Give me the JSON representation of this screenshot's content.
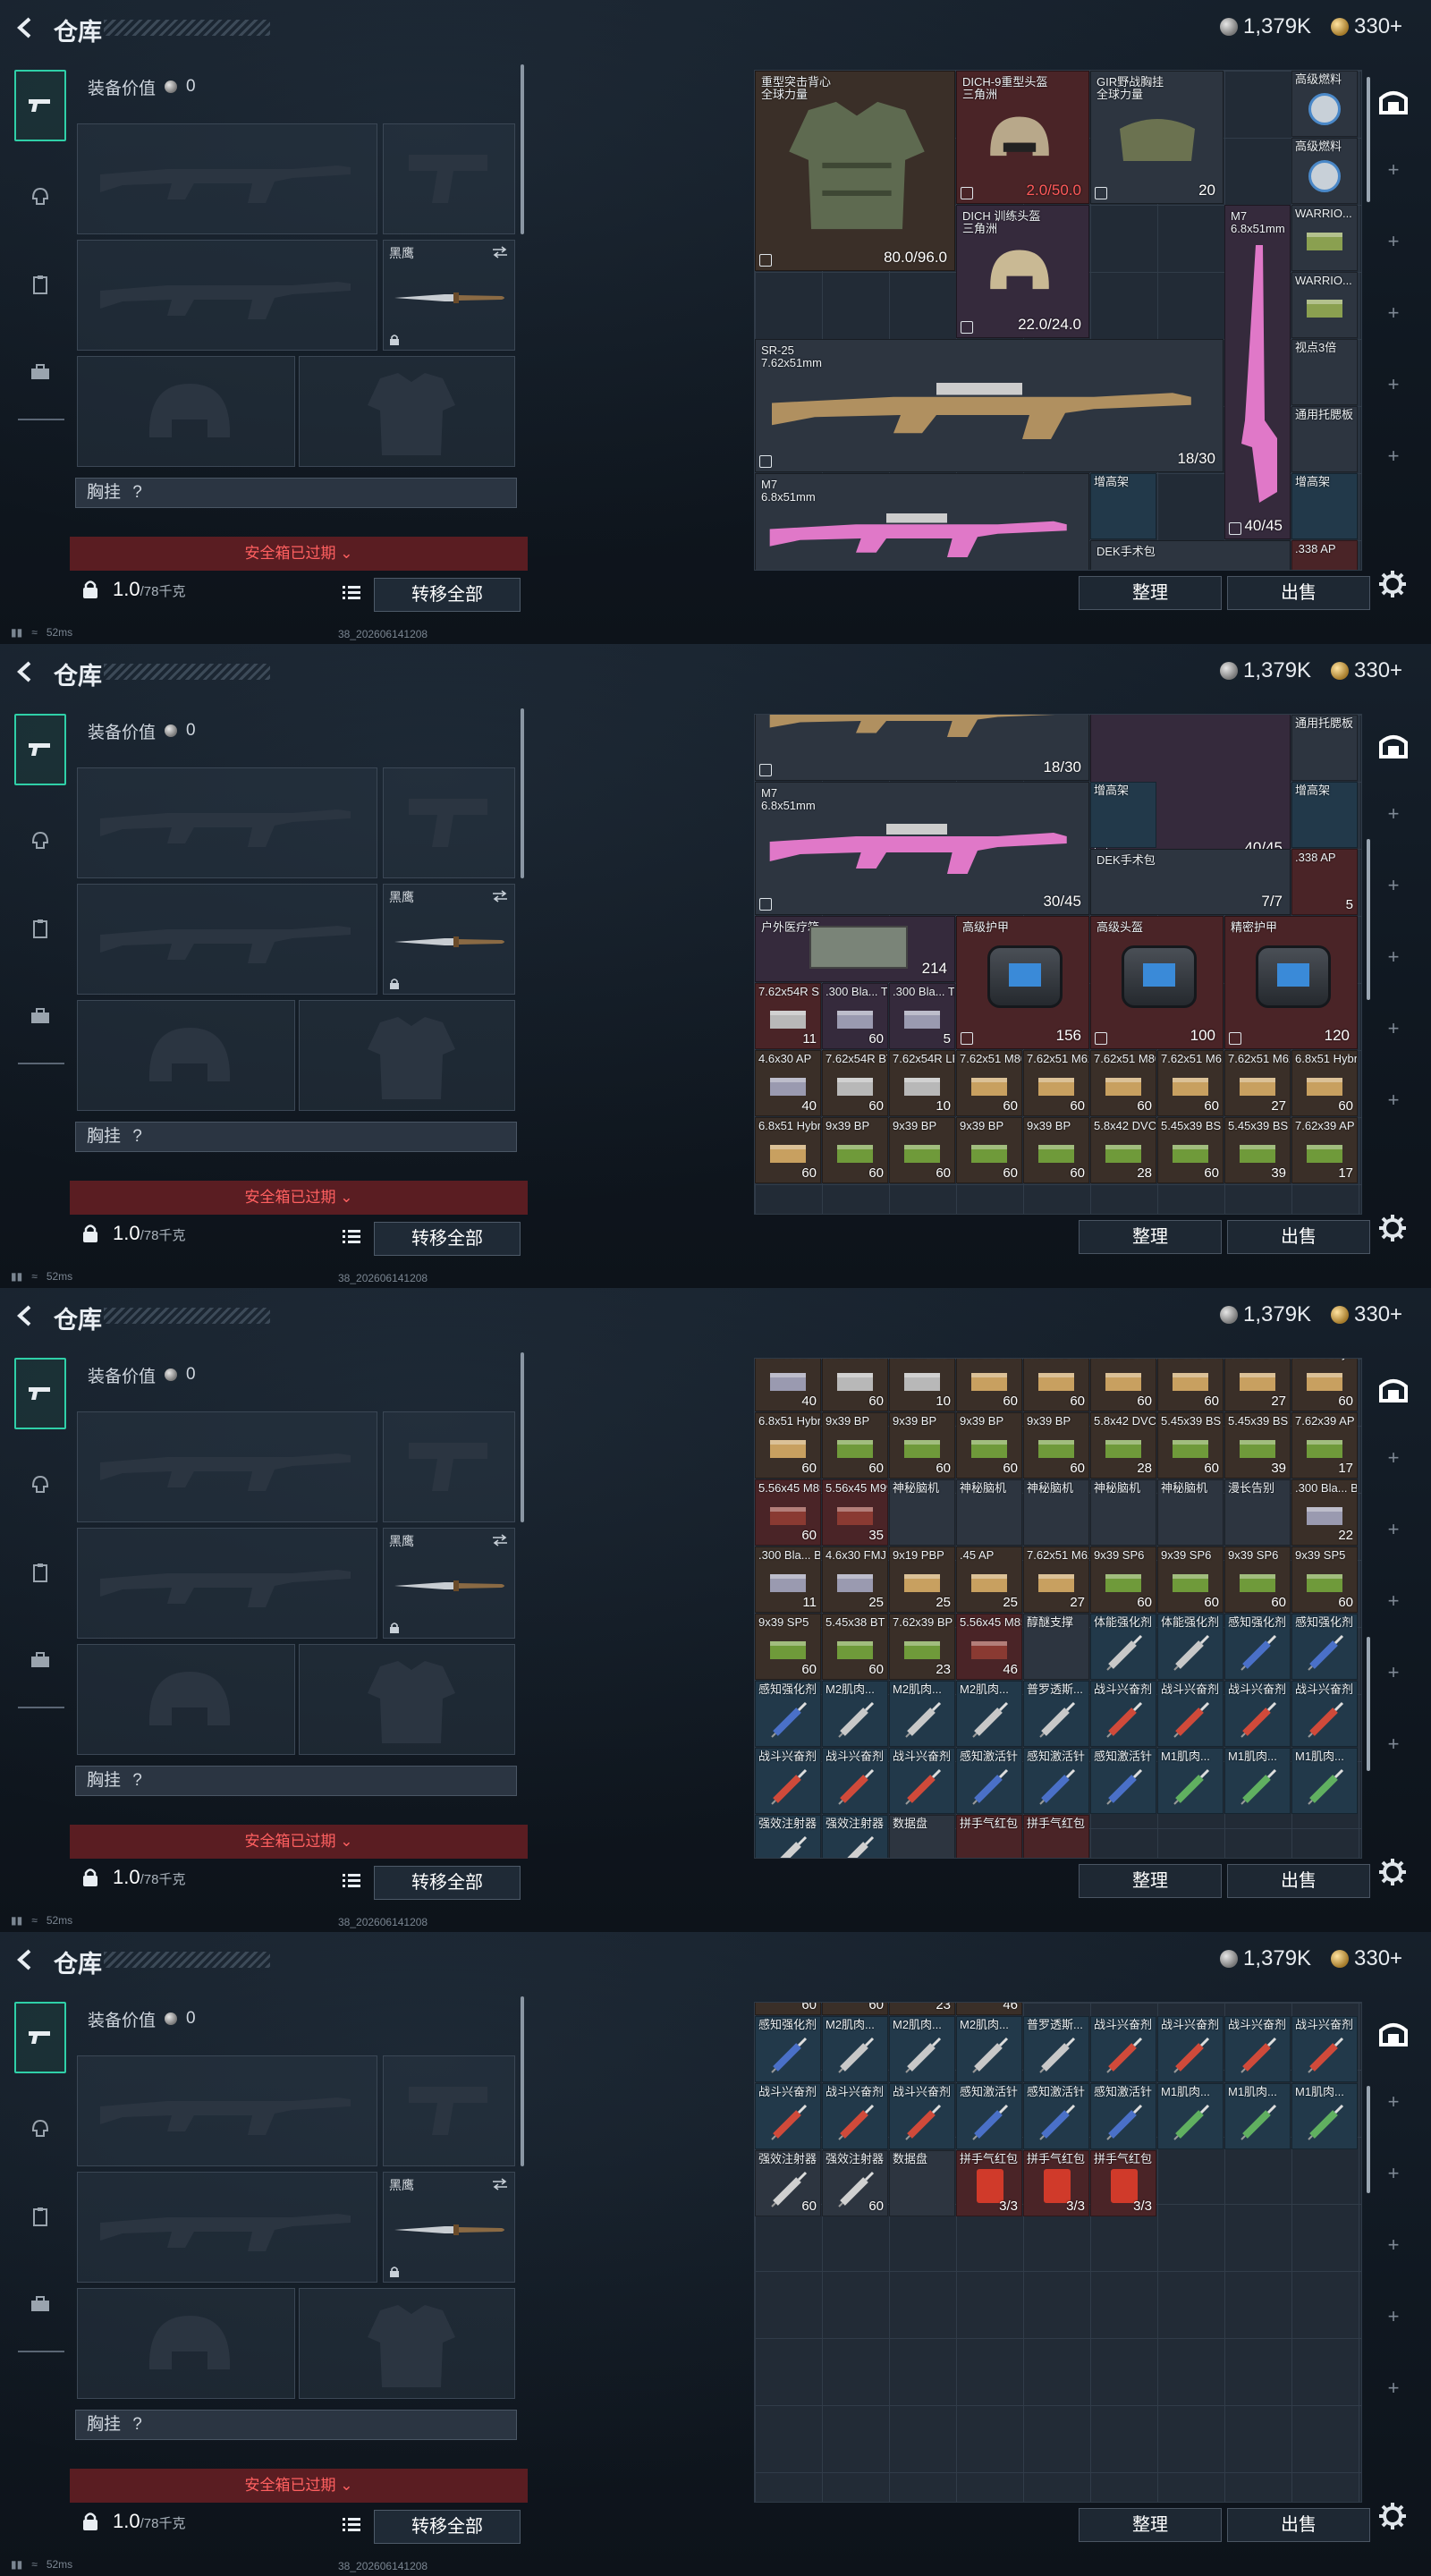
{
  "title": "仓库",
  "currency": {
    "silver": "1,379K",
    "gold": "330+"
  },
  "equip": {
    "value_label": "装备价值",
    "value": "0",
    "knife_label": "黑鹰",
    "chest_label": "胸挂",
    "chest_q": "?",
    "safebox": "安全箱已过期",
    "weight": "1.0",
    "weight_max": "/78千克",
    "move_all": "转移全部"
  },
  "buttons": {
    "sort": "整理",
    "sell": "出售"
  },
  "status": {
    "ping": "52ms",
    "build": "38_202606141208"
  },
  "icons": {
    "back": "back-arrow-icon",
    "silver": "silver-coin-icon",
    "gold": "gold-coin-icon",
    "gear": "gear-icon"
  },
  "frame1": {
    "vest": {
      "name": "重型突击背心",
      "sub": "全球力量",
      "dur": "80.0/96.0"
    },
    "helmet1": {
      "name": "DICH-9重型头盔",
      "sub": "三角洲",
      "dur": "2.0/50.0"
    },
    "helmet2": {
      "name": "DICH 训练头盔",
      "sub": "三角洲",
      "dur": "22.0/24.0"
    },
    "rig": {
      "name": "GIR野战胸挂",
      "sub": "全球力量",
      "cap": "20"
    },
    "fuel1": "高级燃料",
    "fuel2": "高级燃料",
    "warrior1": "WARRIO...",
    "warrior2": "WARRIO...",
    "scope": "视点3倍",
    "stock": "通用托腮板",
    "m7a": {
      "name": "M7",
      "sub": "6.8x51mm",
      "ammo": "40/45"
    },
    "sr25": {
      "name": "SR-25",
      "sub": "7.62x51mm",
      "ammo": "18/30"
    },
    "m7b": {
      "name": "M7",
      "sub": "6.8x51mm"
    },
    "riser1": "增高架",
    "riser2": "增高架",
    "dek": "DEK手术包",
    "ap338": ".338 AP"
  },
  "frame2": {
    "sr25_ammo": "18/30",
    "m7_ammo": "40/45",
    "stock": "通用托腮板",
    "m7b": {
      "name": "M7",
      "sub": "6.8x51mm",
      "ammo": "30/45"
    },
    "riser1": "增高架",
    "riser2": "增高架",
    "dek": {
      "name": "DEK手术包",
      "ct": "7/7"
    },
    "ap338": {
      "name": ".338 AP",
      "ct": "5"
    },
    "medkit": {
      "name": "户外医疗箱",
      "ct": "214"
    },
    "armor1": {
      "name": "高级护甲",
      "ct": "156"
    },
    "armor2": {
      "name": "高级头盔",
      "ct": "100"
    },
    "armor3": {
      "name": "精密护甲",
      "ct": "120"
    },
    "row1": [
      {
        "n": "7.62x54R SN",
        "c": "11",
        "bg": "bg-red"
      },
      {
        "n": ".300 Bla... TAC",
        "c": "60",
        "bg": "bg-purple"
      },
      {
        "n": ".300 Bla... TAC",
        "c": "5",
        "bg": "bg-purple"
      }
    ],
    "row2": [
      {
        "n": "4.6x30 AP",
        "c": "40",
        "bg": "bg-brown"
      },
      {
        "n": "7.62x54R BT",
        "c": "60",
        "bg": "bg-brown"
      },
      {
        "n": "7.62x54R LPS",
        "c": "10",
        "bg": "bg-brown"
      },
      {
        "n": "7.62x51 M80",
        "c": "60",
        "bg": "bg-brown"
      },
      {
        "n": "7.62x51 M62",
        "c": "60",
        "bg": "bg-brown"
      },
      {
        "n": "7.62x51 M80",
        "c": "60",
        "bg": "bg-brown"
      },
      {
        "n": "7.62x51 M61",
        "c": "60",
        "bg": "bg-brown"
      },
      {
        "n": "7.62x51 M62",
        "c": "27",
        "bg": "bg-brown"
      },
      {
        "n": "6.8x51 Hybrid",
        "c": "60",
        "bg": "bg-brown"
      }
    ],
    "row3": [
      {
        "n": "6.8x51 Hybrid",
        "c": "60",
        "bg": "bg-brown"
      },
      {
        "n": "9x39 BP",
        "c": "60",
        "bg": "bg-brown"
      },
      {
        "n": "9x39 BP",
        "c": "60",
        "bg": "bg-brown"
      },
      {
        "n": "9x39 BP",
        "c": "60",
        "bg": "bg-brown"
      },
      {
        "n": "9x39 BP",
        "c": "60",
        "bg": "bg-brown"
      },
      {
        "n": "5.8x42 DVC12",
        "c": "28",
        "bg": "bg-brown"
      },
      {
        "n": "5.45x39 BS",
        "c": "60",
        "bg": "bg-brown"
      },
      {
        "n": "5.45x39 BS",
        "c": "39",
        "bg": "bg-brown"
      },
      {
        "n": "7.62x39 AP",
        "c": "17",
        "bg": "bg-brown"
      }
    ]
  },
  "frame3": {
    "row0": [
      {
        "n": "4.6x30 AP",
        "c": "40"
      },
      {
        "n": "7.62x54R BT",
        "c": "60"
      },
      {
        "n": "7.62x54R LPS",
        "c": "10"
      },
      {
        "n": "7.62x51 M80",
        "c": "60"
      },
      {
        "n": "7.62x51 M62",
        "c": "60"
      },
      {
        "n": "7.62x51 M80",
        "c": "60"
      },
      {
        "n": "7.62x51 M61",
        "c": "60"
      },
      {
        "n": "7.62x51 M62",
        "c": "27"
      },
      {
        "n": "6.8x51 Hybrid",
        "c": "60"
      }
    ],
    "row1": [
      {
        "n": "6.8x51 Hybrid",
        "c": "60"
      },
      {
        "n": "9x39 BP",
        "c": "60"
      },
      {
        "n": "9x39 BP",
        "c": "60"
      },
      {
        "n": "9x39 BP",
        "c": "60"
      },
      {
        "n": "9x39 BP",
        "c": "60"
      },
      {
        "n": "5.8x42 DVC12",
        "c": "28"
      },
      {
        "n": "5.45x39 BS",
        "c": "60"
      },
      {
        "n": "5.45x39 BS",
        "c": "39"
      },
      {
        "n": "7.62x39 AP",
        "c": "17"
      }
    ],
    "row2": [
      {
        "n": "5.56x45 M855",
        "c": "60"
      },
      {
        "n": "5.56x45 M995",
        "c": "35"
      },
      {
        "n": "神秘脑机",
        "c": ""
      },
      {
        "n": "神秘脑机",
        "c": ""
      },
      {
        "n": "神秘脑机",
        "c": ""
      },
      {
        "n": "神秘脑机",
        "c": ""
      },
      {
        "n": "神秘脑机",
        "c": ""
      },
      {
        "n": "漫长告别",
        "c": ""
      },
      {
        "n": ".300 Bla... BCP FMJ",
        "c": "22"
      }
    ],
    "row3": [
      {
        "n": ".300 Bla... BCP FMJ",
        "c": "11"
      },
      {
        "n": "4.6x30 FMJ SX",
        "c": "25"
      },
      {
        "n": "9x19 PBP",
        "c": "25"
      },
      {
        "n": ".45 AP",
        "c": "25"
      },
      {
        "n": "7.62x51 M62",
        "c": "27"
      },
      {
        "n": "9x39 SP6",
        "c": "60"
      },
      {
        "n": "9x39 SP6",
        "c": "60"
      },
      {
        "n": "9x39 SP6",
        "c": "60"
      },
      {
        "n": "9x39 SP5",
        "c": "60"
      }
    ],
    "row4": [
      {
        "n": "9x39 SP5",
        "c": "60"
      },
      {
        "n": "5.45x38 BT",
        "c": "60"
      },
      {
        "n": "7.62x39 BP",
        "c": "23"
      },
      {
        "n": "5.56x45 M855A1",
        "c": "46"
      },
      {
        "n": "醇醚支撑",
        "c": ""
      },
      {
        "n": "体能强化剂",
        "c": ""
      },
      {
        "n": "体能强化剂",
        "c": ""
      },
      {
        "n": "感知强化剂",
        "c": ""
      },
      {
        "n": "感知强化剂",
        "c": ""
      }
    ],
    "row5": [
      {
        "n": "感知强化剂",
        "c": ""
      },
      {
        "n": "M2肌肉...",
        "c": ""
      },
      {
        "n": "M2肌肉...",
        "c": ""
      },
      {
        "n": "M2肌肉...",
        "c": ""
      },
      {
        "n": "普罗透斯...",
        "c": ""
      },
      {
        "n": "战斗兴奋剂",
        "c": ""
      },
      {
        "n": "战斗兴奋剂",
        "c": ""
      },
      {
        "n": "战斗兴奋剂",
        "c": ""
      },
      {
        "n": "战斗兴奋剂",
        "c": ""
      }
    ],
    "row6": [
      {
        "n": "战斗兴奋剂",
        "c": ""
      },
      {
        "n": "战斗兴奋剂",
        "c": ""
      },
      {
        "n": "战斗兴奋剂",
        "c": ""
      },
      {
        "n": "感知激活针",
        "c": ""
      },
      {
        "n": "感知激活针",
        "c": ""
      },
      {
        "n": "感知激活针",
        "c": ""
      },
      {
        "n": "M1肌肉...",
        "c": ""
      },
      {
        "n": "M1肌肉...",
        "c": ""
      },
      {
        "n": "M1肌肉...",
        "c": ""
      }
    ],
    "row7": [
      {
        "n": "强效注射器",
        "c": ""
      },
      {
        "n": "强效注射器",
        "c": ""
      },
      {
        "n": "数据盘",
        "c": ""
      },
      {
        "n": "拼手气红包",
        "c": ""
      },
      {
        "n": "拼手气红包",
        "c": ""
      }
    ]
  },
  "frame4": {
    "row0c": [
      "60",
      "60",
      "23",
      "46"
    ],
    "row1": [
      "感知强化剂",
      "M2肌肉...",
      "M2肌肉...",
      "M2肌肉...",
      "普罗透斯...",
      "战斗兴奋剂",
      "战斗兴奋剂",
      "战斗兴奋剂",
      "战斗兴奋剂"
    ],
    "row2": [
      "战斗兴奋剂",
      "战斗兴奋剂",
      "战斗兴奋剂",
      "感知激活针",
      "感知激活针",
      "感知激活针",
      "M1肌肉...",
      "M1肌肉...",
      "M1肌肉..."
    ],
    "row3": [
      {
        "n": "强效注射器",
        "c": "60"
      },
      {
        "n": "强效注射器",
        "c": "60"
      },
      {
        "n": "数据盘",
        "c": ""
      },
      {
        "n": "拼手气红包",
        "c": "3/3"
      },
      {
        "n": "拼手气红包",
        "c": "3/3"
      },
      {
        "n": "拼手气红包",
        "c": "3/3"
      }
    ]
  }
}
